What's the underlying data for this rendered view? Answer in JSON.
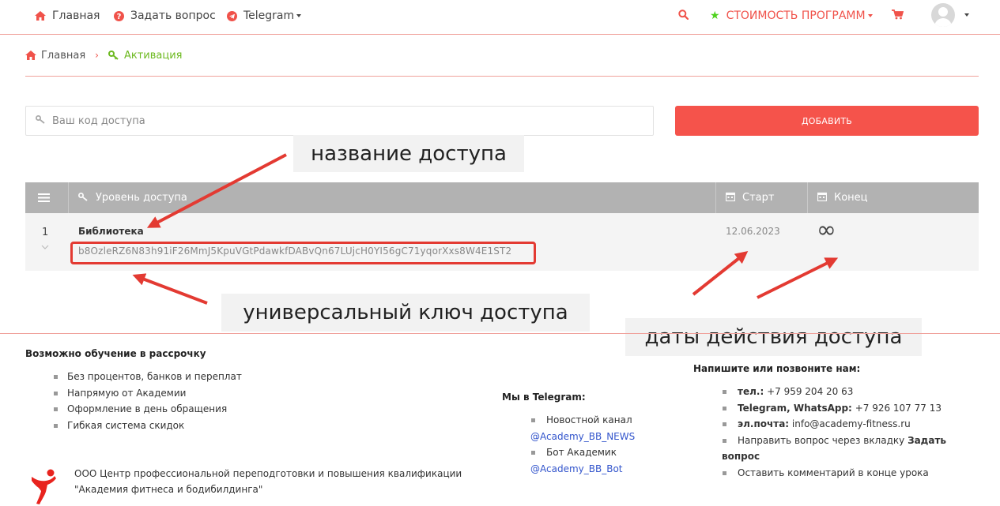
{
  "nav": {
    "home": "Главная",
    "ask": "Задать вопрос",
    "telegram": "Telegram",
    "price": "СТОИМОСТЬ ПРОГРАММ"
  },
  "breadcrumb": {
    "home": "Главная",
    "current": "Активация"
  },
  "access_form": {
    "placeholder": "Ваш код доступа",
    "button": "ДОБАВИТЬ"
  },
  "table": {
    "columns": {
      "level": "Уровень доступа",
      "start": "Старт",
      "end": "Конец"
    },
    "rows": [
      {
        "num": "1",
        "title": "Библиотека",
        "key": "b8OzleRZ6N83h91iF26MmJ5KpuVGtPdawkfDABvQn67LUjcH0YI56gC71yqorXxs8W4E1ST2",
        "start": "12.06.2023",
        "end": "∞"
      }
    ]
  },
  "annotations": {
    "name": "название доступа",
    "key": "универсальный ключ доступа",
    "dates": "даты действия доступа",
    "color": "#e33a32"
  },
  "footer": {
    "installment_title": "Возможно обучение в рассрочку",
    "installment_items": [
      "Без процентов, банков и переплат",
      "Напрямую от Академии",
      "Оформление в день обращения",
      "Гибкая система скидок"
    ],
    "org_line1": "ООО Центр профессиональной переподготовки и повышения квалификации",
    "org_line2": "\"Академия фитнеса и бодибилдинга\"",
    "telegram_title": "Мы в Telegram:",
    "telegram_news_label": "Новостной канал",
    "telegram_news_link": "@Academy_BB_NEWS",
    "telegram_bot_label": "Бот Академик",
    "telegram_bot_link": "@Academy_BB_Bot",
    "contact_title": "Напишите или позвоните нам:",
    "phone_label": "тел.:",
    "phone": "+7 959 204 20 63",
    "messengers_label": "Telegram, WhatsApp:",
    "messengers_phone": "+7 926 107 77 13",
    "email_label": "эл.почта:",
    "email": "info@academy-fitness.ru",
    "ask_prefix": "Направить вопрос через вкладку",
    "ask_bold_1": "Задать",
    "ask_bold_2": "вопрос",
    "comment": "Оставить комментарий в конце урока"
  },
  "colors": {
    "accent": "#f5534b",
    "active": "#6cb91f",
    "table_header": "#b2b2b2"
  }
}
